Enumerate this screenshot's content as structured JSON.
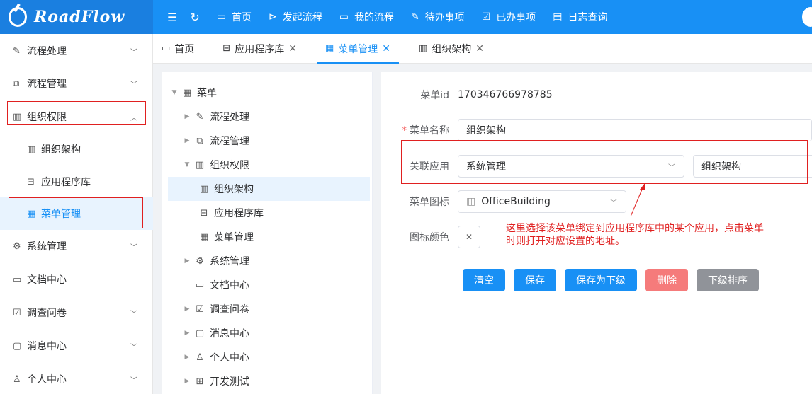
{
  "app": {
    "logo_text": "RoadFlow"
  },
  "topnav": [
    {
      "label": "首页",
      "icon": "monitor-icon"
    },
    {
      "label": "发起流程",
      "icon": "play-circle-icon"
    },
    {
      "label": "我的流程",
      "icon": "folder-icon"
    },
    {
      "label": "待办事项",
      "icon": "edit-icon"
    },
    {
      "label": "已办事项",
      "icon": "folder-check-icon"
    },
    {
      "label": "日志查询",
      "icon": "document-icon"
    }
  ],
  "sidebar": {
    "items": [
      {
        "label": "流程处理",
        "icon": "edit-icon"
      },
      {
        "label": "流程管理",
        "icon": "share-icon"
      },
      {
        "label": "组织权限",
        "icon": "building-icon"
      },
      {
        "label": "组织架构",
        "icon": "building-icon"
      },
      {
        "label": "应用程序库",
        "icon": "box-icon"
      },
      {
        "label": "菜单管理",
        "icon": "grid-icon"
      },
      {
        "label": "系统管理",
        "icon": "gear-icon"
      },
      {
        "label": "文档中心",
        "icon": "folder-icon"
      },
      {
        "label": "调查问卷",
        "icon": "survey-icon"
      },
      {
        "label": "消息中心",
        "icon": "message-icon"
      },
      {
        "label": "个人中心",
        "icon": "user-icon"
      }
    ]
  },
  "tabs": [
    {
      "label": "首页",
      "icon": "monitor-icon",
      "closable": false
    },
    {
      "label": "应用程序库",
      "icon": "box-icon",
      "closable": true
    },
    {
      "label": "菜单管理",
      "icon": "grid-icon",
      "closable": true,
      "active": true
    },
    {
      "label": "组织架构",
      "icon": "building-icon",
      "closable": true
    }
  ],
  "tree": [
    {
      "label": "菜单",
      "icon": "grid-icon"
    },
    {
      "label": "流程处理",
      "icon": "edit-icon"
    },
    {
      "label": "流程管理",
      "icon": "share-icon"
    },
    {
      "label": "组织权限",
      "icon": "building-icon"
    },
    {
      "label": "组织架构",
      "icon": "building-icon"
    },
    {
      "label": "应用程序库",
      "icon": "box-icon"
    },
    {
      "label": "菜单管理",
      "icon": "grid-icon"
    },
    {
      "label": "系统管理",
      "icon": "gear-icon"
    },
    {
      "label": "文档中心",
      "icon": "folder-icon"
    },
    {
      "label": "调查问卷",
      "icon": "survey-icon"
    },
    {
      "label": "消息中心",
      "icon": "message-icon"
    },
    {
      "label": "个人中心",
      "icon": "user-icon"
    },
    {
      "label": "开发测试",
      "icon": "chip-icon"
    }
  ],
  "form": {
    "menu_id_label": "菜单id",
    "menu_id_value": "170346766978785",
    "name_label": "菜单名称",
    "name_value": "组织架构",
    "app_label": "关联应用",
    "app_value_1": "系统管理",
    "app_value_2": "组织架构",
    "icon_label": "菜单图标",
    "icon_value": "OfficeBuilding",
    "color_label": "图标颜色"
  },
  "buttons": {
    "clear": "清空",
    "save": "保存",
    "save_child": "保存为下级",
    "delete": "删除",
    "sort": "下级排序"
  },
  "annotation": {
    "line1": "这里选择该菜单绑定到应用程序库中的某个应用，点击菜单",
    "line2": "时则打开对应设置的地址。"
  },
  "colors": {
    "primary": "#1890f5",
    "danger": "#f57b7b",
    "info": "#909399",
    "annotation": "#e02020"
  }
}
